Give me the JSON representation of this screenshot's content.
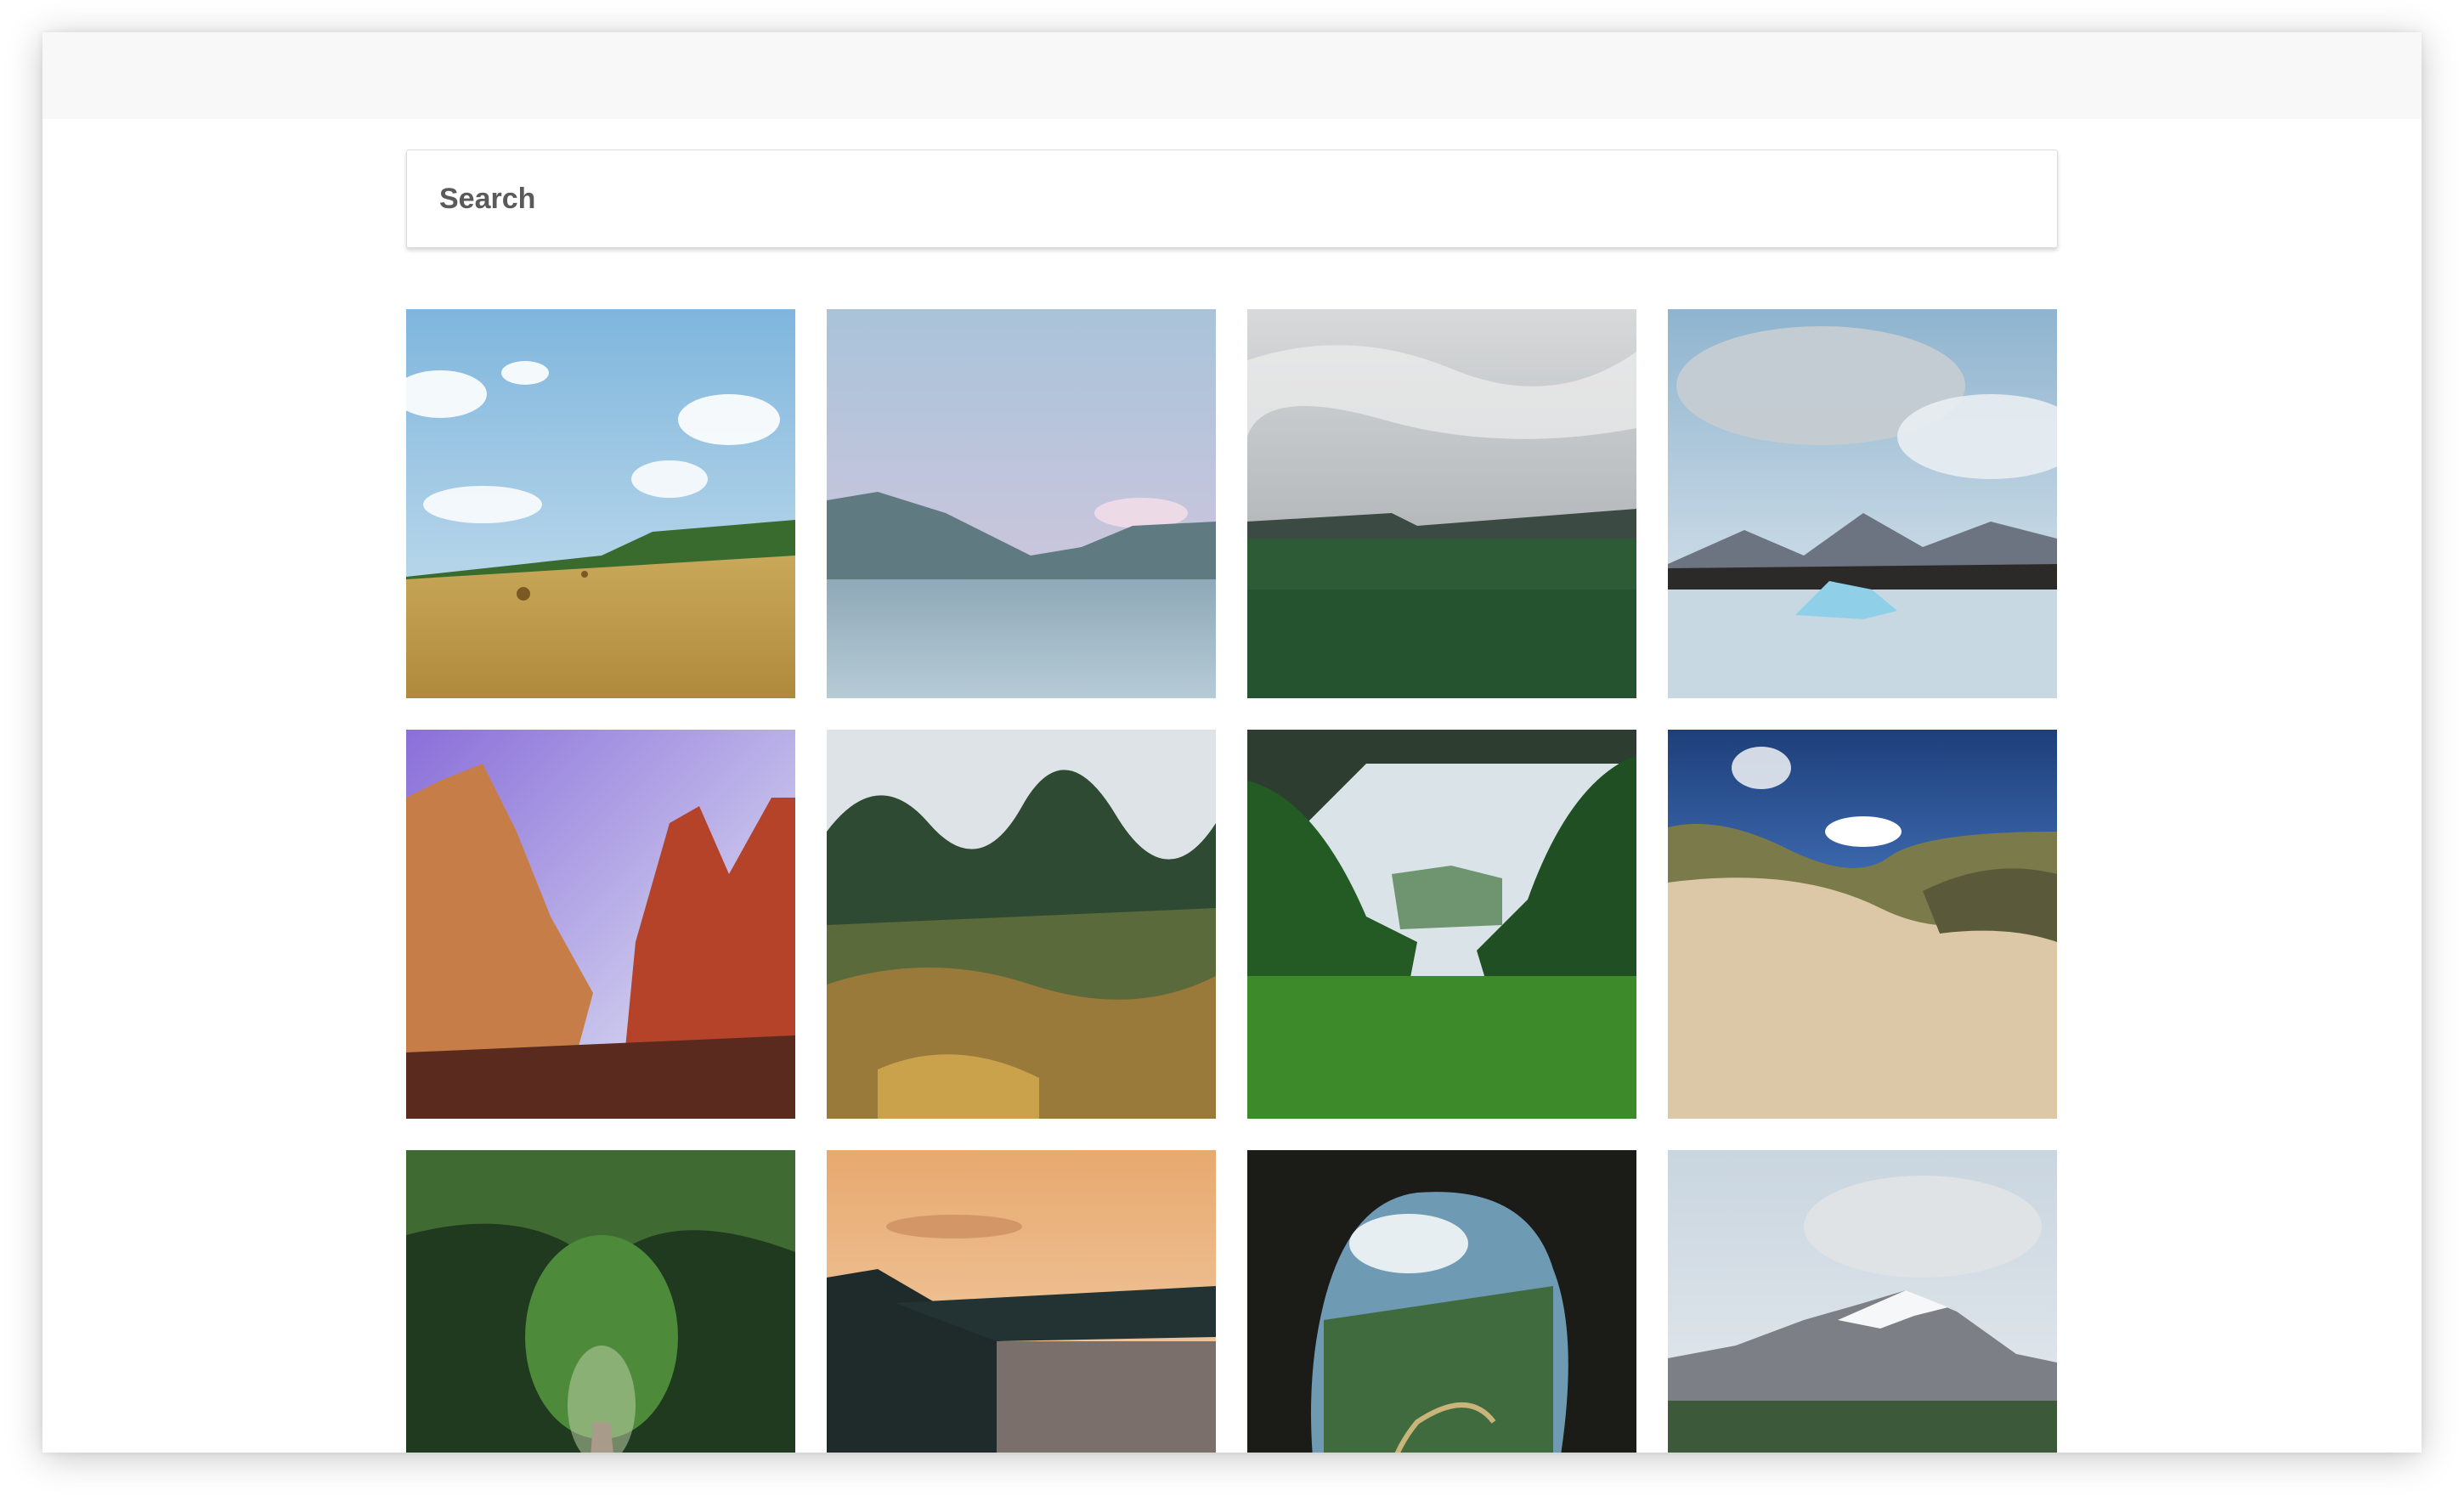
{
  "search": {
    "placeholder": "Search",
    "value": ""
  },
  "colors": {
    "topbar": "#f8f8f8",
    "search_border": "#dcdcdc",
    "placeholder": "#5a5a5a"
  }
}
